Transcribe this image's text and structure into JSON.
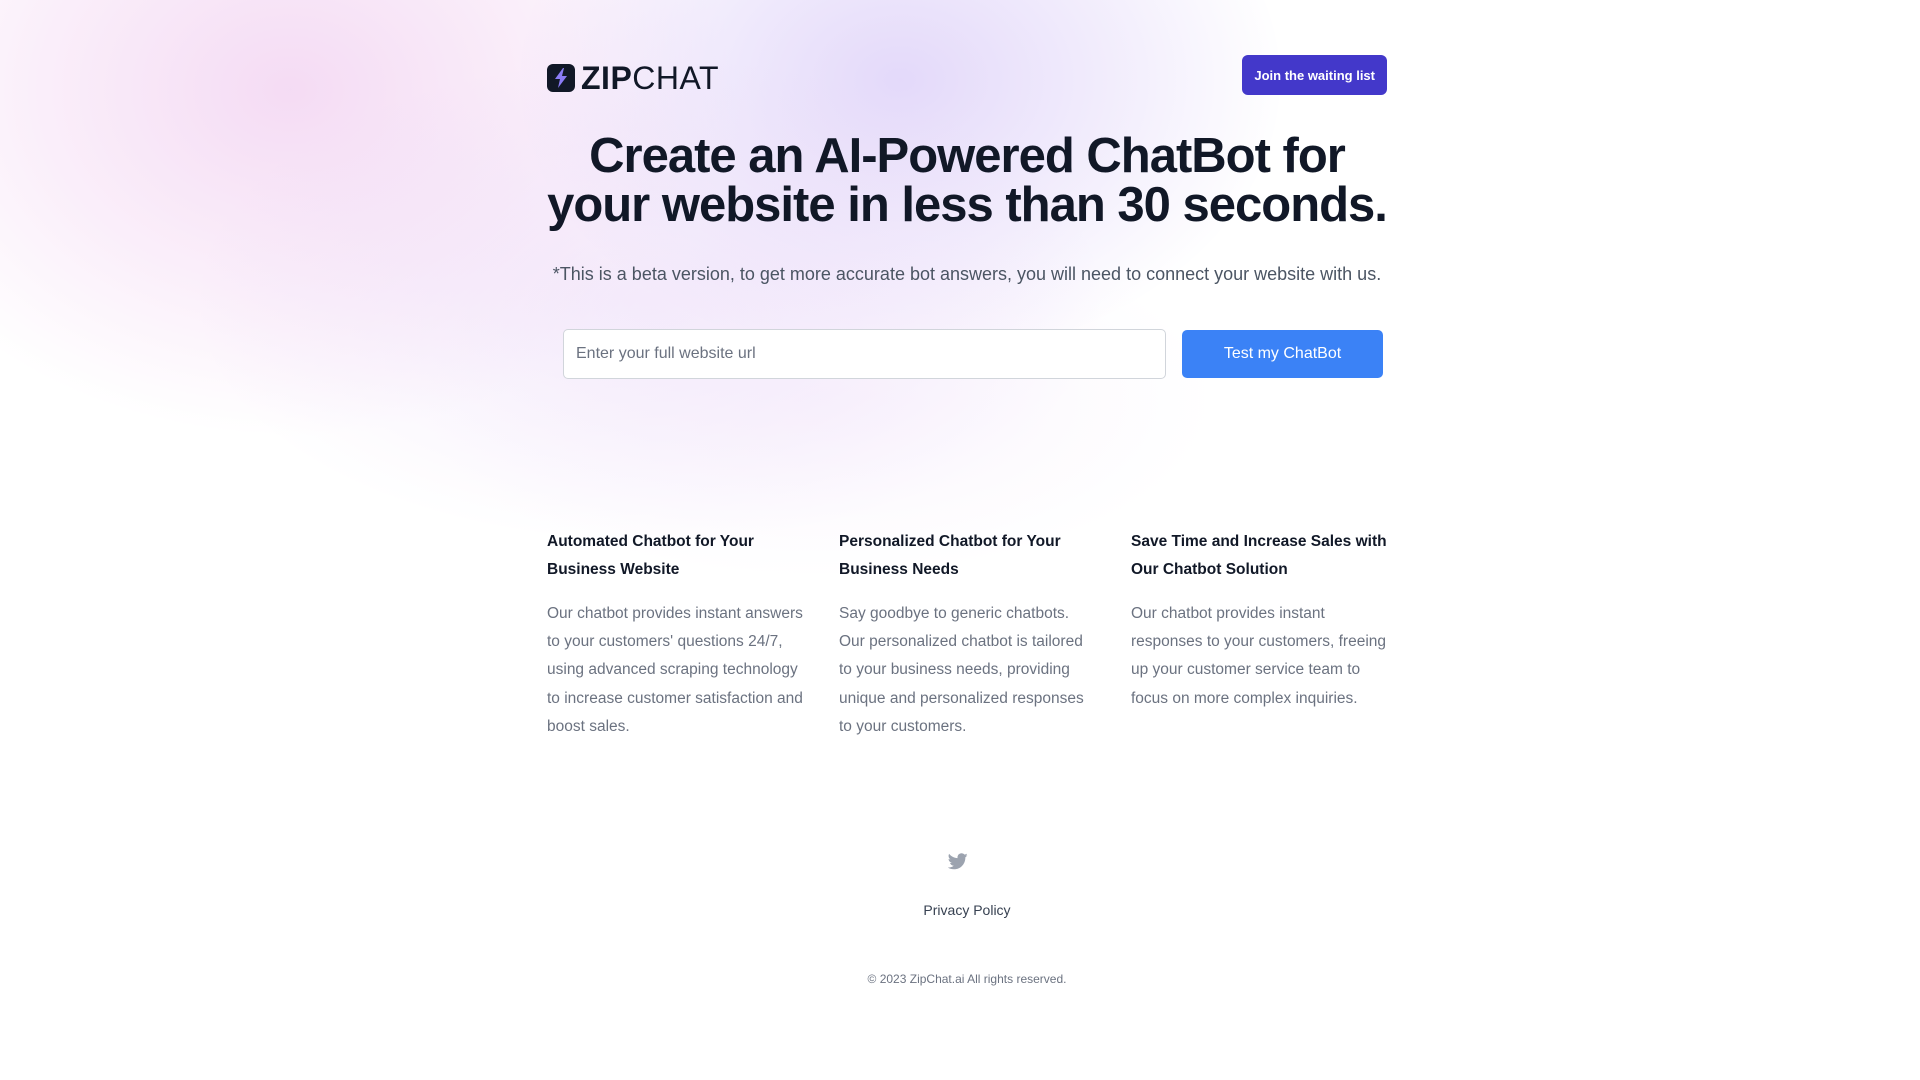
{
  "header": {
    "logo_bold": "ZIP",
    "logo_light": "CHAT",
    "waitlist_button": "Join the waiting list"
  },
  "hero": {
    "title": "Create an AI-Powered ChatBot for your website in less than 30 seconds.",
    "subtitle": "*This is a beta version, to get more accurate bot answers, you will need to connect your website with us.",
    "url_placeholder": "Enter your full website url",
    "url_value": "",
    "test_button": "Test my ChatBot"
  },
  "features": [
    {
      "title": "Automated Chatbot for Your Business Website",
      "description": "Our chatbot provides instant answers to your customers' questions 24/7, using advanced scraping technology to increase customer satisfaction and boost sales."
    },
    {
      "title": "Personalized Chatbot for Your Business Needs",
      "description": "Say goodbye to generic chatbots. Our personalized chatbot is tailored to your business needs, providing unique and personalized responses to your customers."
    },
    {
      "title": "Save Time and Increase Sales with Our Chatbot Solution",
      "description": "Our chatbot provides instant responses to your customers, freeing up your customer service team to focus on more complex inquiries."
    }
  ],
  "footer": {
    "social_icon": "twitter-icon",
    "privacy_link": "Privacy Policy",
    "copyright": "© 2023 ZipChat.ai All rights reserved."
  },
  "colors": {
    "waitlist_button": "#4338ca",
    "test_button": "#3b82f6",
    "heading": "#111827",
    "body_text": "#6b7280"
  }
}
